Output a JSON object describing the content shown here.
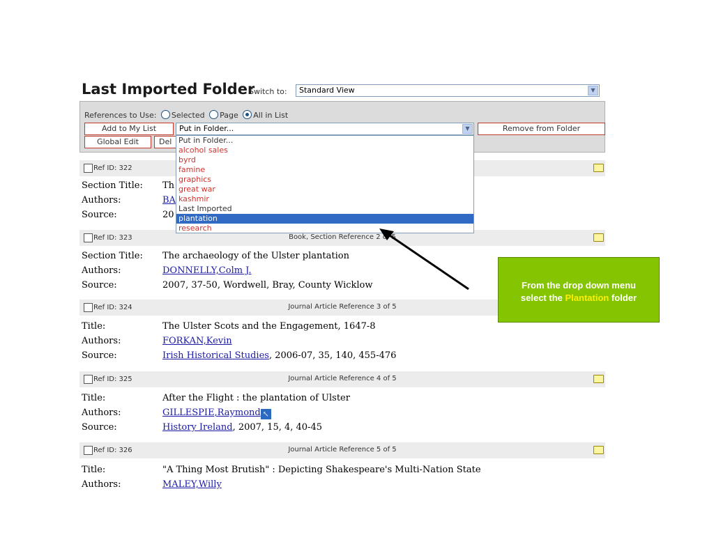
{
  "header": {
    "title": "Last Imported Folder",
    "switch_label": "Switch to:",
    "view_value": "Standard View"
  },
  "toolbar": {
    "refs_label": "References to Use:",
    "radio_selected": "Selected",
    "radio_page": "Page",
    "radio_all": "All in List",
    "add_to_my_list": "Add to My List",
    "global_edit": "Global Edit",
    "delete_partial": "Del",
    "remove_from_folder": "Remove from Folder",
    "folder_select_value": "Put in Folder..."
  },
  "dropdown": {
    "options": [
      "Put in Folder...",
      "alcohol sales",
      "byrd",
      "famine",
      "graphics",
      "great war",
      "kashmir",
      "Last Imported",
      "plantation",
      "research"
    ],
    "highlighted": "plantation"
  },
  "references": [
    {
      "ref_id": "Ref ID: 322",
      "type_label": "",
      "fields": [
        {
          "label": "Section Title:",
          "value": "Th"
        },
        {
          "label": "Authors:",
          "value": "BA",
          "link": true
        },
        {
          "label": "Source:",
          "value": "20"
        }
      ]
    },
    {
      "ref_id": "Ref ID: 323",
      "type_label": "Book, Section Reference 2 of 5",
      "fields": [
        {
          "label": "Section Title:",
          "value": "The archaeology of the Ulster plantation"
        },
        {
          "label": "Authors:",
          "value": "DONNELLY,Colm J.",
          "link": true
        },
        {
          "label": "Source:",
          "value": "2007, 37-50, Wordwell, Bray, County Wicklow"
        }
      ]
    },
    {
      "ref_id": "Ref ID: 324",
      "type_label": "Journal Article Reference 3 of 5",
      "fields": [
        {
          "label": "Title:",
          "value": "The Ulster Scots and the Engagement, 1647-8"
        },
        {
          "label": "Authors:",
          "value": "FORKAN,Kevin",
          "link": true
        },
        {
          "label": "Source:",
          "link_part": "Irish Historical Studies",
          "value": ", 2006-07, 35, 140, 455-476"
        }
      ]
    },
    {
      "ref_id": "Ref ID: 325",
      "type_label": "Journal Article Reference 4 of 5",
      "fields": [
        {
          "label": "Title:",
          "value": "After the Flight : the plantation of Ulster"
        },
        {
          "label": "Authors:",
          "value": "GILLESPIE,Raymond",
          "link": true
        },
        {
          "label": "Source:",
          "link_part": "History Ireland",
          "value": ", 2007, 15, 4, 40-45"
        }
      ]
    },
    {
      "ref_id": "Ref ID: 326",
      "type_label": "Journal Article Reference 5 of 5",
      "fields": [
        {
          "label": "Title:",
          "value": "\"A Thing Most Brutish\" : Depicting Shakespeare's Multi-Nation State"
        },
        {
          "label": "Authors:",
          "value": "MALEY,Willy",
          "link": true
        }
      ]
    }
  ],
  "callout": {
    "line1": "From the drop down menu",
    "line2_prefix": "select the",
    "line2_highlight": "Plantation",
    "line2_suffix": "folder"
  },
  "colors": {
    "callout_bg": "#84c400",
    "highlight_text": "#ffee00",
    "folder_option": "#d0312d",
    "selection": "#316ac5",
    "link": "#1a1aa6"
  }
}
